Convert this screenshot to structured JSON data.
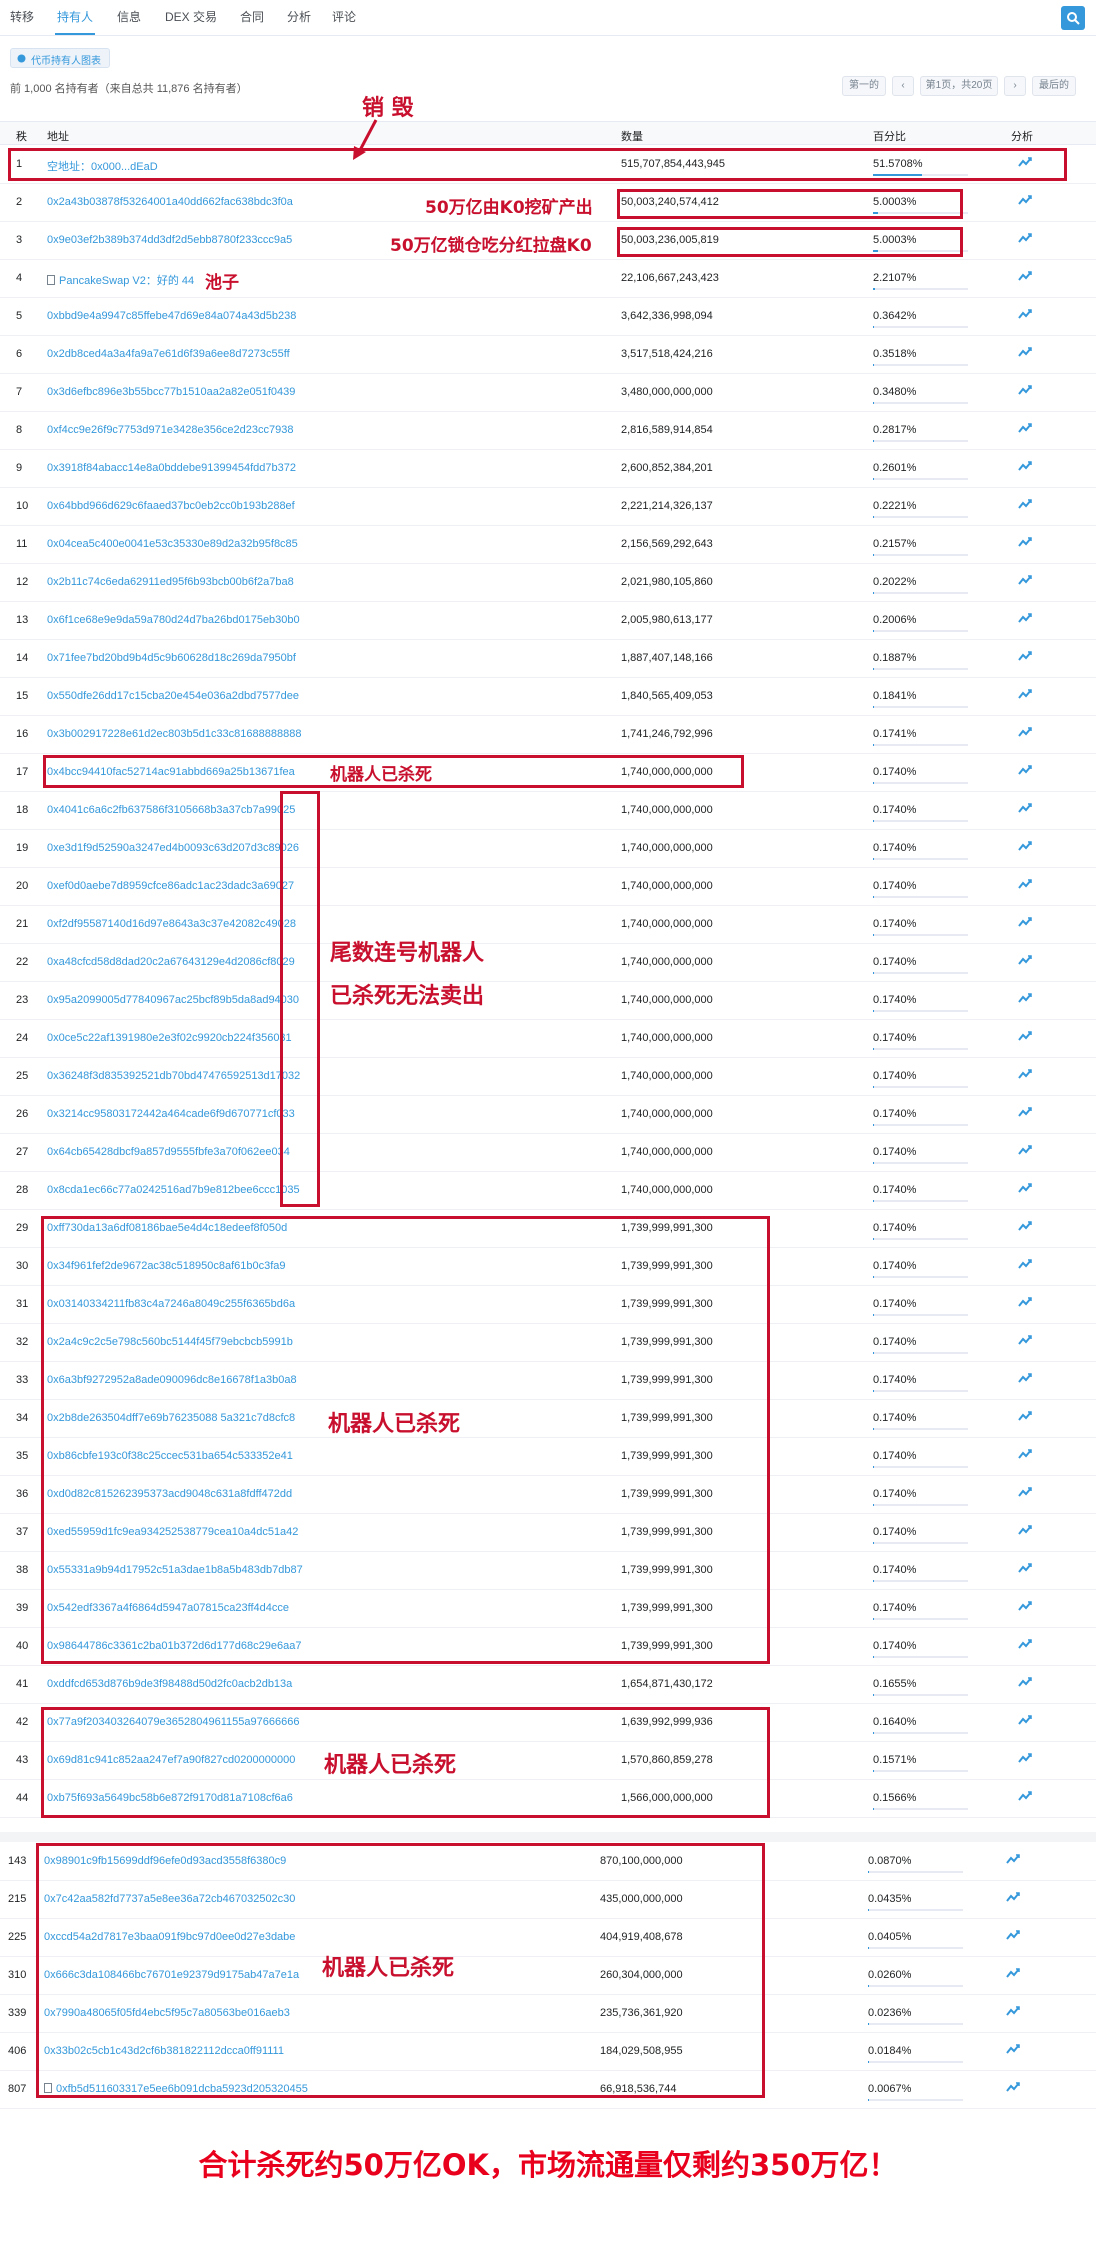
{
  "tabs": [
    "转移",
    "持有人",
    "信息",
    "DEX 交易",
    "合同",
    "分析",
    "评论"
  ],
  "chart_button": "代币持有人图表",
  "summary": "前 1,000 名持有者（来自总共 11,876 名持有者）",
  "pager": {
    "first": "第一的",
    "current": "第1页，共20页",
    "last": "最后的"
  },
  "table_headers": {
    "rank": "秩",
    "address": "地址",
    "quantity": "数量",
    "percentage": "百分比",
    "analytics": "分析"
  },
  "rows": [
    {
      "rank": "1",
      "address": "空地址：0x000...dEaD",
      "quantity": "515,707,854,443,945",
      "percentage": "51.5708%",
      "fill": 51.57
    },
    {
      "rank": "2",
      "address": "0x2a43b03878f53264001a40dd662fac638bdc3f0a",
      "quantity": "50,003,240,574,412",
      "percentage": "5.0003%",
      "fill": 5.0
    },
    {
      "rank": "3",
      "address": "0x9e03ef2b389b374dd3df2d5ebb8780f233ccc9a5",
      "quantity": "50,003,236,005,819",
      "percentage": "5.0003%",
      "fill": 5.0
    },
    {
      "rank": "4",
      "address": "PancakeSwap V2：好的 44",
      "quantity": "22,106,667,243,423",
      "percentage": "2.2107%",
      "fill": 2.21
    },
    {
      "rank": "5",
      "address": "0xbbd9e4a9947c85ffebe47d69e84a074a43d5b238",
      "quantity": "3,642,336,998,094",
      "percentage": "0.3642%",
      "fill": 0.36
    },
    {
      "rank": "6",
      "address": "0x2db8ced4a3a4fa9a7e61d6f39a6ee8d7273c55ff",
      "quantity": "3,517,518,424,216",
      "percentage": "0.3518%",
      "fill": 0.35
    },
    {
      "rank": "7",
      "address": "0x3d6efbc896e3b55bcc77b1510aa2a82e051f0439",
      "quantity": "3,480,000,000,000",
      "percentage": "0.3480%",
      "fill": 0.35
    },
    {
      "rank": "8",
      "address": "0xf4cc9e26f9c7753d971e3428e356ce2d23cc7938",
      "quantity": "2,816,589,914,854",
      "percentage": "0.2817%",
      "fill": 0.28
    },
    {
      "rank": "9",
      "address": "0x3918f84abacc14e8a0bddebe91399454fdd7b372",
      "quantity": "2,600,852,384,201",
      "percentage": "0.2601%",
      "fill": 0.26
    },
    {
      "rank": "10",
      "address": "0x64bbd966d629c6faaed37bc0eb2cc0b193b288ef",
      "quantity": "2,221,214,326,137",
      "percentage": "0.2221%",
      "fill": 0.22
    },
    {
      "rank": "11",
      "address": "0x04cea5c400e0041e53c35330e89d2a32b95f8c85",
      "quantity": "2,156,569,292,643",
      "percentage": "0.2157%",
      "fill": 0.22
    },
    {
      "rank": "12",
      "address": "0x2b11c74c6eda62911ed95f6b93bcb00b6f2a7ba8",
      "quantity": "2,021,980,105,860",
      "percentage": "0.2022%",
      "fill": 0.2
    },
    {
      "rank": "13",
      "address": "0x6f1ce68e9e9da59a780d24d7ba26bd0175eb30b0",
      "quantity": "2,005,980,613,177",
      "percentage": "0.2006%",
      "fill": 0.2
    },
    {
      "rank": "14",
      "address": "0x71fee7bd20bd9b4d5c9b60628d18c269da7950bf",
      "quantity": "1,887,407,148,166",
      "percentage": "0.1887%",
      "fill": 0.19
    },
    {
      "rank": "15",
      "address": "0x550dfe26dd17c15cba20e454e036a2dbd7577dee",
      "quantity": "1,840,565,409,053",
      "percentage": "0.1841%",
      "fill": 0.18
    },
    {
      "rank": "16",
      "address": "0x3b002917228e61d2ec803b5d1c33c81688888888",
      "quantity": "1,741,246,792,996",
      "percentage": "0.1741%",
      "fill": 0.17
    },
    {
      "rank": "17",
      "address": "0x4bcc94410fac52714ac91abbd669a25b13671fea",
      "quantity": "1,740,000,000,000",
      "percentage": "0.1740%",
      "fill": 0.17
    },
    {
      "rank": "18",
      "address": "0x4041c6a6c2fb637586f3105668b3a37cb7a99025",
      "quantity": "1,740,000,000,000",
      "percentage": "0.1740%",
      "fill": 0.17
    },
    {
      "rank": "19",
      "address": "0xe3d1f9d52590a3247ed4b0093c63d207d3c89026",
      "quantity": "1,740,000,000,000",
      "percentage": "0.1740%",
      "fill": 0.17
    },
    {
      "rank": "20",
      "address": "0xef0d0aebe7d8959cfce86adc1ac23dadc3a69027",
      "quantity": "1,740,000,000,000",
      "percentage": "0.1740%",
      "fill": 0.17
    },
    {
      "rank": "21",
      "address": "0xf2df95587140d16d97e8643a3c37e42082c49028",
      "quantity": "1,740,000,000,000",
      "percentage": "0.1740%",
      "fill": 0.17
    },
    {
      "rank": "22",
      "address": "0xa48cfcd58d8dad20c2a67643129e4d2086cf8029",
      "quantity": "1,740,000,000,000",
      "percentage": "0.1740%",
      "fill": 0.17
    },
    {
      "rank": "23",
      "address": "0x95a2099005d77840967ac25bcf89b5da8ad94030",
      "quantity": "1,740,000,000,000",
      "percentage": "0.1740%",
      "fill": 0.17
    },
    {
      "rank": "24",
      "address": "0x0ce5c22af1391980e2e3f02c9920cb224f356031",
      "quantity": "1,740,000,000,000",
      "percentage": "0.1740%",
      "fill": 0.17
    },
    {
      "rank": "25",
      "address": "0x36248f3d835392521db70bd47476592513d17032",
      "quantity": "1,740,000,000,000",
      "percentage": "0.1740%",
      "fill": 0.17
    },
    {
      "rank": "26",
      "address": "0x3214cc95803172442a464cade6f9d670771cf033",
      "quantity": "1,740,000,000,000",
      "percentage": "0.1740%",
      "fill": 0.17
    },
    {
      "rank": "27",
      "address": "0x64cb65428dbcf9a857d9555fbfe3a70f062ee034",
      "quantity": "1,740,000,000,000",
      "percentage": "0.1740%",
      "fill": 0.17
    },
    {
      "rank": "28",
      "address": "0x8cda1ec66c77a0242516ad7b9e812bee6ccc1035",
      "quantity": "1,740,000,000,000",
      "percentage": "0.1740%",
      "fill": 0.17
    },
    {
      "rank": "29",
      "address": "0xff730da13a6df08186bae5e4d4c18edeef8f050d",
      "quantity": "1,739,999,991,300",
      "percentage": "0.1740%",
      "fill": 0.17
    },
    {
      "rank": "30",
      "address": "0x34f961fef2de9672ac38c518950c8af61b0c3fa9",
      "quantity": "1,739,999,991,300",
      "percentage": "0.1740%",
      "fill": 0.17
    },
    {
      "rank": "31",
      "address": "0x03140334211fb83c4a7246a8049c255f6365bd6a",
      "quantity": "1,739,999,991,300",
      "percentage": "0.1740%",
      "fill": 0.17
    },
    {
      "rank": "32",
      "address": "0x2a4c9c2c5e798c560bc5144f45f79ebcbcb5991b",
      "quantity": "1,739,999,991,300",
      "percentage": "0.1740%",
      "fill": 0.17
    },
    {
      "rank": "33",
      "address": "0x6a3bf9272952a8ade090096dc8e16678f1a3b0a8",
      "quantity": "1,739,999,991,300",
      "percentage": "0.1740%",
      "fill": 0.17
    },
    {
      "rank": "34",
      "address": "0x2b8de263504dff7e69b76235088 5a321c7d8cfc8",
      "quantity": "1,739,999,991,300",
      "percentage": "0.1740%",
      "fill": 0.17
    },
    {
      "rank": "35",
      "address": "0xb86cbfe193c0f38c25ccec531ba654c533352e41",
      "quantity": "1,739,999,991,300",
      "percentage": "0.1740%",
      "fill": 0.17
    },
    {
      "rank": "36",
      "address": "0xd0d82c815262395373acd9048c631a8fdff472dd",
      "quantity": "1,739,999,991,300",
      "percentage": "0.1740%",
      "fill": 0.17
    },
    {
      "rank": "37",
      "address": "0xed55959d1fc9ea934252538779cea10a4dc51a42",
      "quantity": "1,739,999,991,300",
      "percentage": "0.1740%",
      "fill": 0.17
    },
    {
      "rank": "38",
      "address": "0x55331a9b94d17952c51a3dae1b8a5b483db7db87",
      "quantity": "1,739,999,991,300",
      "percentage": "0.1740%",
      "fill": 0.17
    },
    {
      "rank": "39",
      "address": "0x542edf3367a4f6864d5947a07815ca23ff4d4cce",
      "quantity": "1,739,999,991,300",
      "percentage": "0.1740%",
      "fill": 0.17
    },
    {
      "rank": "40",
      "address": "0x98644786c3361c2ba01b372d6d177d68c29e6aa7",
      "quantity": "1,739,999,991,300",
      "percentage": "0.1740%",
      "fill": 0.17
    },
    {
      "rank": "41",
      "address": "0xddfcd653d876b9de3f98488d50d2fc0acb2db13a",
      "quantity": "1,654,871,430,172",
      "percentage": "0.1655%",
      "fill": 0.17
    },
    {
      "rank": "42",
      "address": "0x77a9f203403264079e3652804961155a97666666",
      "quantity": "1,639,992,999,936",
      "percentage": "0.1640%",
      "fill": 0.16
    },
    {
      "rank": "43",
      "address": "0x69d81c941c852aa247ef7a90f827cd0200000000",
      "quantity": "1,570,860,859,278",
      "percentage": "0.1571%",
      "fill": 0.16
    },
    {
      "rank": "44",
      "address": "0xb75f693a5649bc58b6e872f9170d81a7108cf6a6",
      "quantity": "1,566,000,000,000",
      "percentage": "0.1566%",
      "fill": 0.16
    }
  ],
  "rows2": [
    {
      "rank": "143",
      "address": "0x98901c9fb15699ddf96efe0d93acd3558f6380c9",
      "quantity": "870,100,000,000",
      "percentage": "0.0870%",
      "fill": 0.09
    },
    {
      "rank": "215",
      "address": "0x7c42aa582fd7737a5e8ee36a72cb467032502c30",
      "quantity": "435,000,000,000",
      "percentage": "0.0435%",
      "fill": 0.04
    },
    {
      "rank": "225",
      "address": "0xccd54a2d7817e3baa091f9bc97d0ee0d27e3dabe",
      "quantity": "404,919,408,678",
      "percentage": "0.0405%",
      "fill": 0.04
    },
    {
      "rank": "310",
      "address": "0x666c3da108466bc76701e92379d9175ab47a7e1a",
      "quantity": "260,304,000,000",
      "percentage": "0.0260%",
      "fill": 0.03
    },
    {
      "rank": "339",
      "address": "0x7990a48065f05fd4ebc5f95c7a80563be016aeb3",
      "quantity": "235,736,361,920",
      "percentage": "0.0236%",
      "fill": 0.02
    },
    {
      "rank": "406",
      "address": "0x33b02c5cb1c43d2cf6b381822112dcca0ff91111",
      "quantity": "184,029,508,955",
      "percentage": "0.0184%",
      "fill": 0.02
    },
    {
      "rank": "807",
      "address": "0xfb5d511603317e5ee6b091dcba5923d205320455",
      "quantity": "66,918,536,744",
      "percentage": "0.0067%",
      "fill": 0.01
    }
  ],
  "annotations": {
    "burn": "销 毁",
    "mining": "50万亿由K0挖矿产出",
    "locked": "50万亿锁仓吃分红拉盘K0",
    "pool": "池子",
    "robot_killed_17": "机器人已杀死",
    "sequential_line1": "尾数连号机器人",
    "sequential_line2": "已杀死无法卖出",
    "robot_killed_29_40": "机器人已杀死",
    "robot_killed_42_44": "机器人已杀死",
    "robot_killed_lower": "机器人已杀死",
    "footer": "合计杀死约50万亿OK，市场流通量仅剩约350万亿！"
  },
  "colors": {
    "accent": "#3498db",
    "annotation_red": "#c8102e"
  }
}
